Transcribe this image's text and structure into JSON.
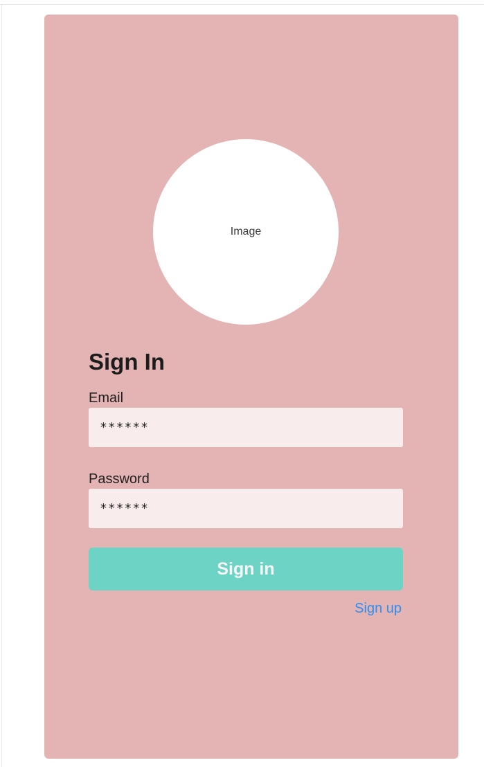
{
  "signin": {
    "image_placeholder": "Image",
    "title": "Sign In",
    "email_label": "Email",
    "email_value": "******",
    "password_label": "Password",
    "password_value": "******",
    "submit_label": "Sign in",
    "signup_link": "Sign up"
  },
  "colors": {
    "card_background": "#e4b4b4",
    "input_background": "#f8ecec",
    "button_background": "#6dd3c5",
    "link": "#2b8ef2"
  }
}
